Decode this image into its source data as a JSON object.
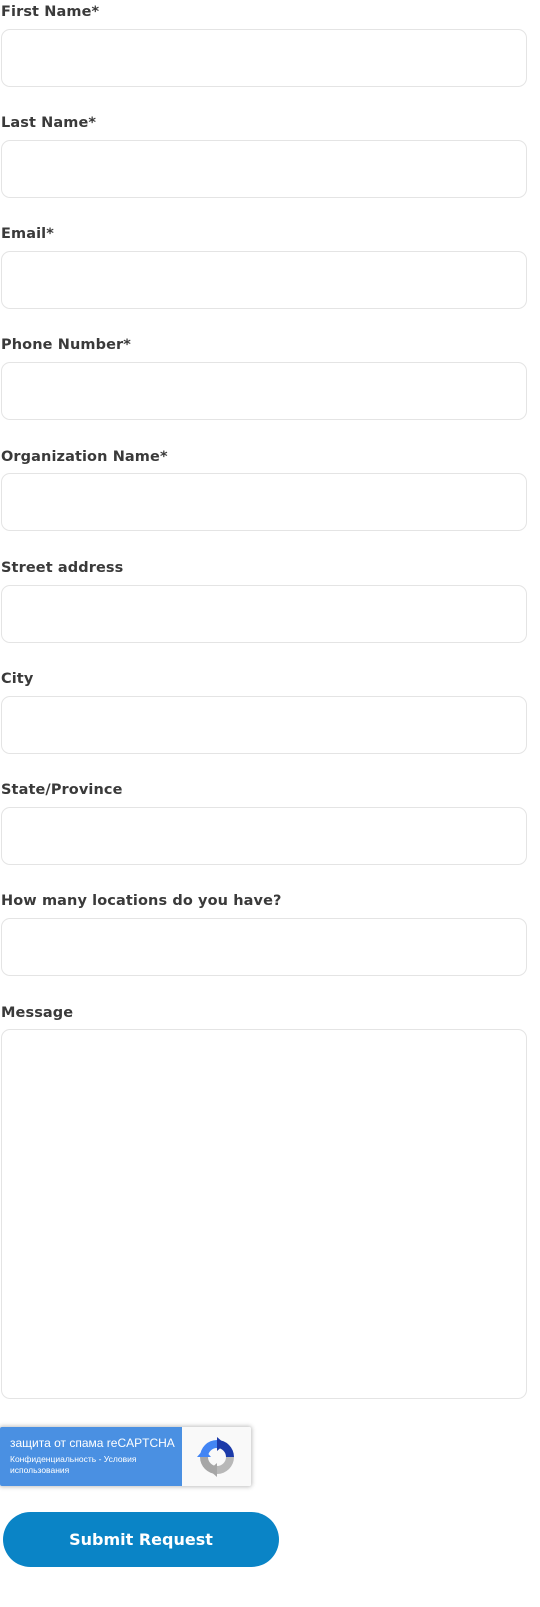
{
  "form": {
    "fields": [
      {
        "label": "First Name*",
        "value": "",
        "placeholder": ""
      },
      {
        "label": "Last Name*",
        "value": "",
        "placeholder": ""
      },
      {
        "label": "Email*",
        "value": "",
        "placeholder": ""
      },
      {
        "label": "Phone Number*",
        "value": "",
        "placeholder": ""
      },
      {
        "label": "Organization Name*",
        "value": "",
        "placeholder": ""
      },
      {
        "label": "Street address",
        "value": "",
        "placeholder": ""
      },
      {
        "label": "City",
        "value": "",
        "placeholder": ""
      },
      {
        "label": "State/Province",
        "value": "",
        "placeholder": ""
      },
      {
        "label": "How many locations do you have?",
        "value": "",
        "placeholder": ""
      }
    ],
    "message": {
      "label": "Message",
      "value": "",
      "placeholder": ""
    }
  },
  "recaptcha": {
    "title": "защита от спама reCAPTCHA",
    "privacy_link": "Конфиденциальность",
    "separator": " - ",
    "terms_link": "Условия использования",
    "icon": "recaptcha-logo-icon",
    "colors": {
      "panel": "#4a90e2",
      "logo_bg": "#f9f9f9"
    }
  },
  "submit": {
    "label": "Submit Request",
    "color": "#0a84c6"
  }
}
